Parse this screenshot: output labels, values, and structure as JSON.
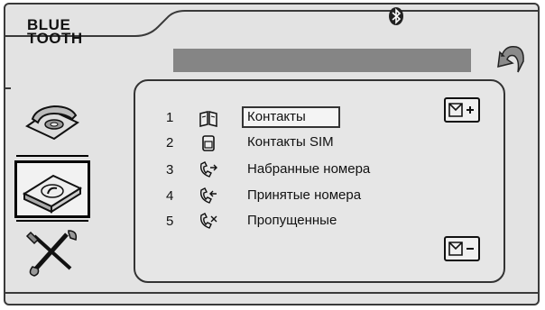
{
  "header": {
    "title_line1": "BLUE",
    "title_line2": "TOOTH",
    "status_text": ""
  },
  "icons": {
    "bluetooth": "bluetooth-icon",
    "back": "back-arrow-icon",
    "phone_tab": "telephone-icon",
    "call_log_tab": "call-log-icon",
    "settings_tab": "tools-icon",
    "add": "add-contact-icon",
    "remove": "remove-contact-icon"
  },
  "menu": [
    {
      "num": "1",
      "label": "Контакты",
      "icon": "contacts-book-icon",
      "selected": true
    },
    {
      "num": "2",
      "label": "Контакты SIM",
      "icon": "sim-card-icon",
      "selected": false
    },
    {
      "num": "3",
      "label": "Набранные номера",
      "icon": "outgoing-call-icon",
      "selected": false
    },
    {
      "num": "4",
      "label": "Принятые номера",
      "icon": "incoming-call-icon",
      "selected": false
    },
    {
      "num": "5",
      "label": "Пропущенные",
      "icon": "missed-call-icon",
      "selected": false
    }
  ],
  "colors": {
    "background": "#e3e3e3",
    "status_bar": "#858585",
    "frame": "#3a3a3a"
  }
}
